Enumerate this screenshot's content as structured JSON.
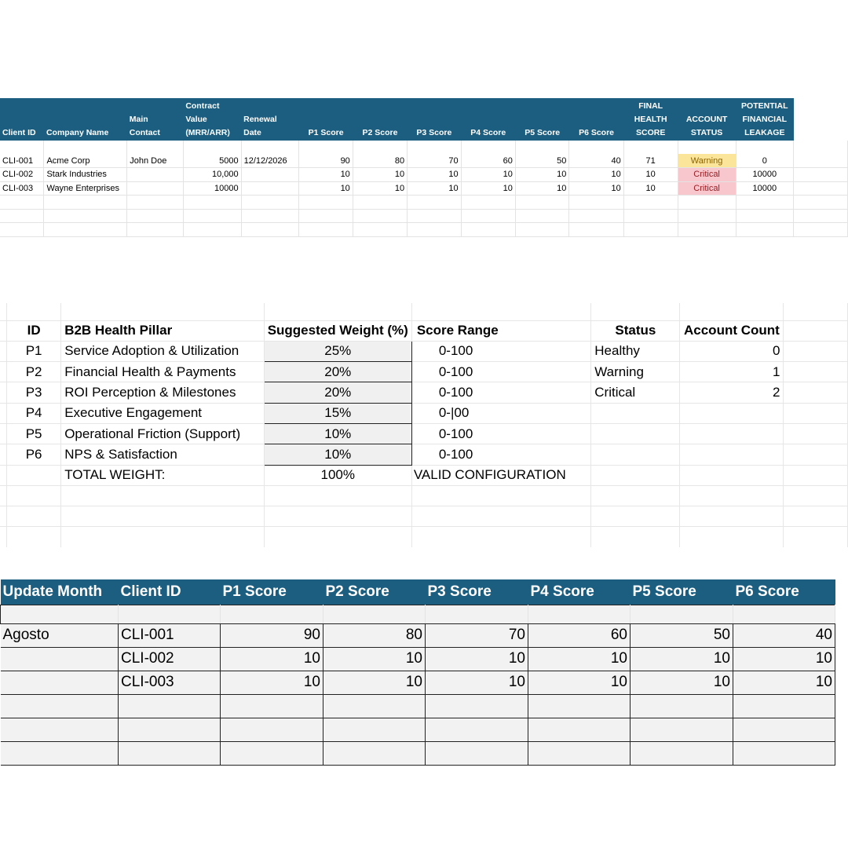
{
  "clients": {
    "headers": {
      "client_id": "Client ID",
      "company_name": "Company Name",
      "main_contact_1": "Main",
      "main_contact_2": "Contact",
      "contract_1": "Contract",
      "contract_2": "Value",
      "contract_3": "(MRR/ARR)",
      "renewal_1": "Renewal",
      "renewal_2": "Date",
      "p1": "P1 Score",
      "p2": "P2 Score",
      "p3": "P3 Score",
      "p4": "P4 Score",
      "p5": "P5 Score",
      "p6": "P6 Score",
      "final_1": "FINAL",
      "final_2": "HEALTH",
      "final_3": "SCORE",
      "status_1": "ACCOUNT",
      "status_2": "STATUS",
      "leak_1": "POTENTIAL",
      "leak_2": "FINANCIAL",
      "leak_3": "LEAKAGE"
    },
    "rows": [
      {
        "id": "CLI-001",
        "company": "Acme Corp",
        "contact": "John Doe",
        "contract": "5000",
        "renewal": "12/12/2026",
        "p1": "90",
        "p2": "80",
        "p3": "70",
        "p4": "60",
        "p5": "50",
        "p6": "40",
        "final": "71",
        "status": "Warning",
        "leakage": "0"
      },
      {
        "id": "CLI-002",
        "company": "Stark Industries",
        "contact": "",
        "contract": "10,000",
        "renewal": "",
        "p1": "10",
        "p2": "10",
        "p3": "10",
        "p4": "10",
        "p5": "10",
        "p6": "10",
        "final": "10",
        "status": "Critical",
        "leakage": "10000"
      },
      {
        "id": "CLI-003",
        "company": "Wayne Enterprises",
        "contact": "",
        "contract": "10000",
        "renewal": "",
        "p1": "10",
        "p2": "10",
        "p3": "10",
        "p4": "10",
        "p5": "10",
        "p6": "10",
        "final": "10",
        "status": "Critical",
        "leakage": "10000"
      }
    ],
    "status_colors": {
      "Warning": "#fbe59a",
      "Critical": "#f8c7cd"
    },
    "header_color": "#1c5e80"
  },
  "pillars": {
    "headers": {
      "id": "ID",
      "pillar": "B2B Health Pillar",
      "weight": "Suggested Weight (%)",
      "range": "Score Range"
    },
    "rows": [
      {
        "id": "P1",
        "pillar": "Service Adoption & Utilization",
        "weight": "25%",
        "range": "0-100"
      },
      {
        "id": "P2",
        "pillar": "Financial Health & Payments",
        "weight": "20%",
        "range": "0-100"
      },
      {
        "id": "P3",
        "pillar": "ROI Perception & Milestones",
        "weight": "20%",
        "range": "0-100"
      },
      {
        "id": "P4",
        "pillar": "Executive Engagement",
        "weight": "15%",
        "range": "0-|00"
      },
      {
        "id": "P5",
        "pillar": "Operational Friction (Support)",
        "weight": "10%",
        "range": "0-100"
      },
      {
        "id": "P6",
        "pillar": "NPS & Satisfaction",
        "weight": "10%",
        "range": "0-100"
      }
    ],
    "total_label": "TOTAL WEIGHT:",
    "total_value": "100%",
    "validation": "VALID CONFIGURATION"
  },
  "status_summary": {
    "headers": {
      "status": "Status",
      "count": "Account Count"
    },
    "rows": [
      {
        "status": "Healthy",
        "count": "0"
      },
      {
        "status": "Warning",
        "count": "1"
      },
      {
        "status": "Critical",
        "count": "2"
      }
    ]
  },
  "updates": {
    "headers": {
      "month": "Update Month",
      "client": "Client ID",
      "p1": "P1 Score",
      "p2": "P2 Score",
      "p3": "P3 Score",
      "p4": "P4 Score",
      "p5": "P5 Score",
      "p6": "P6 Score"
    },
    "rows": [
      {
        "month": "Agosto",
        "client": "CLI-001",
        "p1": "90",
        "p2": "80",
        "p3": "70",
        "p4": "60",
        "p5": "50",
        "p6": "40"
      },
      {
        "month": "",
        "client": "CLI-002",
        "p1": "10",
        "p2": "10",
        "p3": "10",
        "p4": "10",
        "p5": "10",
        "p6": "10"
      },
      {
        "month": "",
        "client": "CLI-003",
        "p1": "10",
        "p2": "10",
        "p3": "10",
        "p4": "10",
        "p5": "10",
        "p6": "10"
      }
    ]
  }
}
